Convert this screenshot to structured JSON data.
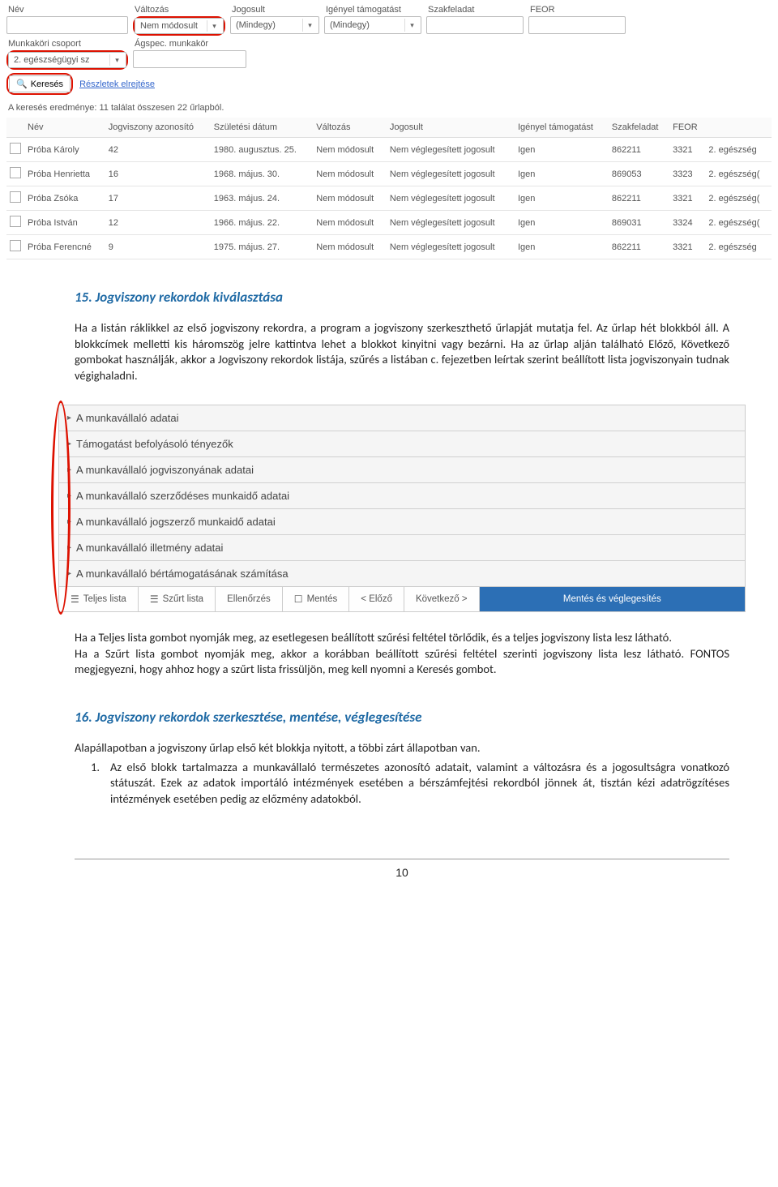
{
  "search_form": {
    "row1": {
      "nev": {
        "label": "Név"
      },
      "valtozas": {
        "label": "Változás",
        "value": "Nem módosult"
      },
      "jogosult": {
        "label": "Jogosult",
        "value": "(Mindegy)"
      },
      "igenyel": {
        "label": "Igényel támogatást",
        "value": "(Mindegy)"
      },
      "szakfeladat": {
        "label": "Szakfeladat"
      },
      "feor": {
        "label": "FEOR"
      }
    },
    "row2": {
      "munkakori": {
        "label": "Munkaköri csoport",
        "value": "2. egészségügyi sz"
      },
      "agspec": {
        "label": "Ágspec. munkakör"
      }
    },
    "search_btn": "Keresés",
    "details_link": "Részletek elrejtése",
    "result_text": "A keresés eredménye: 11 találat összesen 22 űrlapból."
  },
  "results_table": {
    "headers": [
      "",
      "Név",
      "Jogviszony azonosító",
      "Születési dátum",
      "Változás",
      "Jogosult",
      "Igényel támogatást",
      "Szakfeladat",
      "FEOR",
      ""
    ],
    "rows": [
      {
        "nev": "Próba Károly",
        "jog": "42",
        "szul": "1980. augusztus. 25.",
        "valt": "Nem módosult",
        "jogos": "Nem véglegesített jogosult",
        "igen": "Igen",
        "szak": "862211",
        "feor": "3321",
        "grp": "2. egészség"
      },
      {
        "nev": "Próba Henrietta",
        "jog": "16",
        "szul": "1968. május. 30.",
        "valt": "Nem módosult",
        "jogos": "Nem véglegesített jogosult",
        "igen": "Igen",
        "szak": "869053",
        "feor": "3323",
        "grp": "2. egészség("
      },
      {
        "nev": "Próba Zsóka",
        "jog": "17",
        "szul": "1963. május. 24.",
        "valt": "Nem módosult",
        "jogos": "Nem véglegesített jogosult",
        "igen": "Igen",
        "szak": "862211",
        "feor": "3321",
        "grp": "2. egészség("
      },
      {
        "nev": "Próba István",
        "jog": "12",
        "szul": "1966. május. 22.",
        "valt": "Nem módosult",
        "jogos": "Nem véglegesített jogosult",
        "igen": "Igen",
        "szak": "869031",
        "feor": "3324",
        "grp": "2. egészség("
      },
      {
        "nev": "Próba Ferencné",
        "jog": "9",
        "szul": "1975. május. 27.",
        "valt": "Nem módosult",
        "jogos": "Nem véglegesített jogosult",
        "igen": "Igen",
        "szak": "862211",
        "feor": "3321",
        "grp": "2. egészség"
      }
    ]
  },
  "section15": {
    "title": "15. Jogviszony rekordok kiválasztása",
    "p1": "Ha a listán ráklikkel az első jogviszony rekordra, a program a jogviszony szerkeszthető űrlapját mutatja fel. Az űrlap hét blokkból áll. A blokkcímek melletti kis háromszög jelre kattintva lehet a blokkot kinyitni vagy bezárni. Ha az űrlap alján található Előző, Következő gombokat használják, akkor a Jogviszony rekordok listája, szűrés a listában c. fejezetben leírtak szerint beállított lista jogviszonyain tudnak végighaladni."
  },
  "accordion": {
    "items": [
      "A munkavállaló adatai",
      "Támogatást befolyásoló tényezők",
      "A munkavállaló jogviszonyának adatai",
      "A munkavállaló szerződéses munkaidő adatai",
      "A munkavállaló jogszerző munkaidő adatai",
      "A munkavállaló illetmény adatai",
      "A munkavállaló bértámogatásának számítása"
    ],
    "toolbar": {
      "teljes": "Teljes lista",
      "szurt": "Szűrt lista",
      "ellen": "Ellenőrzés",
      "mentes": "Mentés",
      "elozo": "< Előző",
      "kovet": "Következő >",
      "vegleg": "Mentés és véglegesítés"
    }
  },
  "section15b": {
    "p2": "Ha a Teljes lista gombot nyomják meg, az esetlegesen beállított szűrési feltétel törlődik, és a teljes jogviszony lista lesz látható.",
    "p3": "Ha a Szűrt lista gombot nyomják meg, akkor a korábban beállított szűrési feltétel szerinti jogviszony lista lesz látható. FONTOS megjegyezni, hogy ahhoz hogy a szűrt lista frissüljön, meg kell nyomni a Keresés gombot."
  },
  "section16": {
    "title": "16. Jogviszony rekordok szerkesztése, mentése, véglegesítése",
    "p1": "Alapállapotban a jogviszony űrlap első két blokkja nyitott, a többi zárt állapotban van.",
    "li1": "Az első blokk tartalmazza a munkavállaló természetes azonosító adatait, valamint a változásra és a jogosultságra vonatkozó státuszát. Ezek az adatok importáló intézmények esetében a bérszámfejtési rekordból jönnek át, tisztán kézi adatrögzítéses intézmények esetében pedig az előzmény adatokból."
  },
  "page_number": "10"
}
